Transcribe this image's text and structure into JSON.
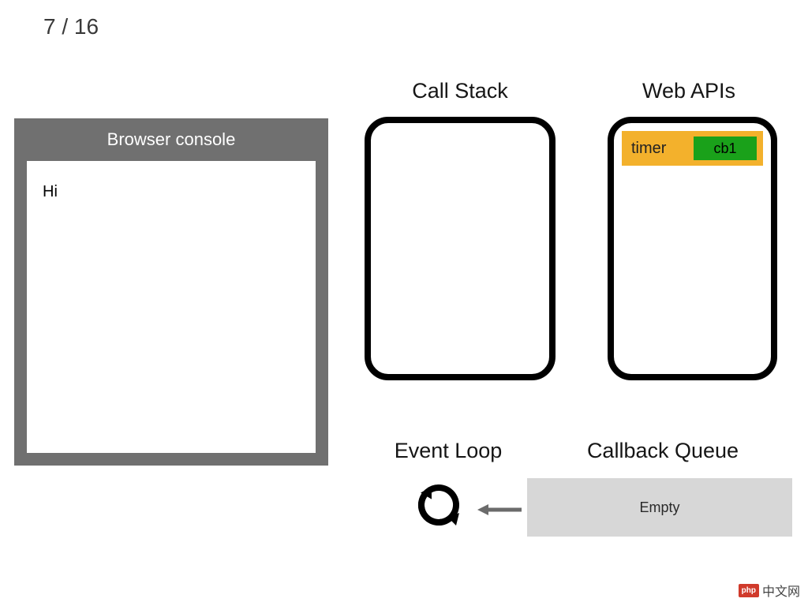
{
  "slide": {
    "counter": "7 / 16"
  },
  "browser": {
    "title": "Browser console",
    "output": "Hi"
  },
  "headings": {
    "callStack": "Call Stack",
    "webApis": "Web APIs",
    "eventLoop": "Event Loop",
    "callbackQueue": "Callback Queue"
  },
  "webApis": {
    "timer": {
      "label": "timer",
      "callback": "cb1"
    }
  },
  "callbackQueue": {
    "state": "Empty"
  },
  "watermark": {
    "badge": "php",
    "text": "中文网"
  }
}
